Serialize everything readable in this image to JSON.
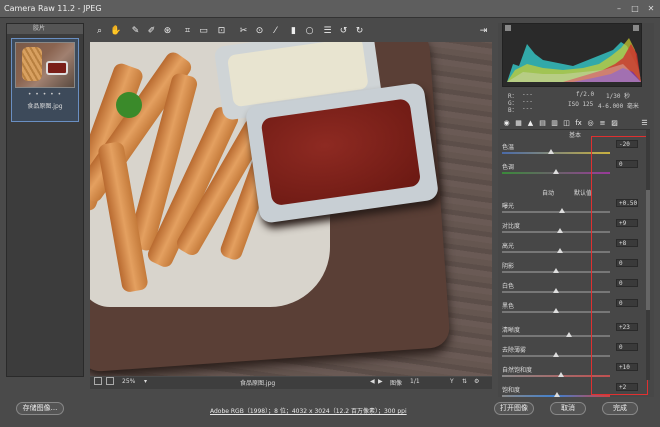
{
  "window": {
    "title": "Camera Raw 11.2 - JPEG"
  },
  "filmstrip": {
    "header": "胶片",
    "thumb_rating": "• • • • •",
    "thumb_caption": "食品原图.jpg"
  },
  "toolbar": {
    "icons": [
      "zoom-icon",
      "hand-icon",
      "white-balance-icon",
      "color-sampler-icon",
      "target-adjust-icon",
      "crop-icon",
      "straighten-icon",
      "transform-icon",
      "spot-removal-icon",
      "red-eye-icon",
      "adjustment-brush-icon",
      "graduated-filter-icon",
      "radial-filter-icon",
      "preferences-icon",
      "rotate-ccw-icon",
      "rotate-cw-icon"
    ],
    "open_icon": "export-icon"
  },
  "camera_info": {
    "r": "R：",
    "g": "G：",
    "b": "B：",
    "r_val": "---",
    "g_val": "---",
    "b_val": "---",
    "aperture": "f/2.0",
    "shutter": "1/30 秒",
    "iso": "ISO 125",
    "lens": "4-6.000 毫米"
  },
  "panel": {
    "title": "基本",
    "auto": "自动",
    "default": "默认值"
  },
  "sliders": [
    {
      "label": "色温",
      "value": "-20",
      "pos": 0.45,
      "track": "temp"
    },
    {
      "label": "色调",
      "value": "0",
      "pos": 0.5,
      "track": "tint"
    },
    {
      "label": "曝光",
      "value": "+0.50",
      "pos": 0.56,
      "track": "gray"
    },
    {
      "label": "对比度",
      "value": "+9",
      "pos": 0.54,
      "track": "gray"
    },
    {
      "label": "高光",
      "value": "+8",
      "pos": 0.54,
      "track": "gray"
    },
    {
      "label": "阴影",
      "value": "0",
      "pos": 0.5,
      "track": "gray"
    },
    {
      "label": "白色",
      "value": "0",
      "pos": 0.5,
      "track": "gray"
    },
    {
      "label": "黑色",
      "value": "0",
      "pos": 0.5,
      "track": "gray"
    },
    {
      "label": "清晰度",
      "value": "+23",
      "pos": 0.62,
      "track": "gray"
    },
    {
      "label": "去除薄雾",
      "value": "0",
      "pos": 0.5,
      "track": "gray"
    },
    {
      "label": "自然饱和度",
      "value": "+10",
      "pos": 0.55,
      "track": "vib"
    },
    {
      "label": "饱和度",
      "value": "+2",
      "pos": 0.51,
      "track": "sat"
    }
  ],
  "statusbar": {
    "zoom": "25%",
    "filename": "食品原图.jpg",
    "image_label": "图像",
    "page": "1/1"
  },
  "bottom": {
    "save": "存储图像...",
    "info": "Adobe RGB（1998）；8 位；4032 x 3024（12.2 百万像素）；300 ppi",
    "open": "打开图像",
    "cancel": "取消",
    "done": "完成"
  },
  "histogram": {
    "shown": true
  }
}
